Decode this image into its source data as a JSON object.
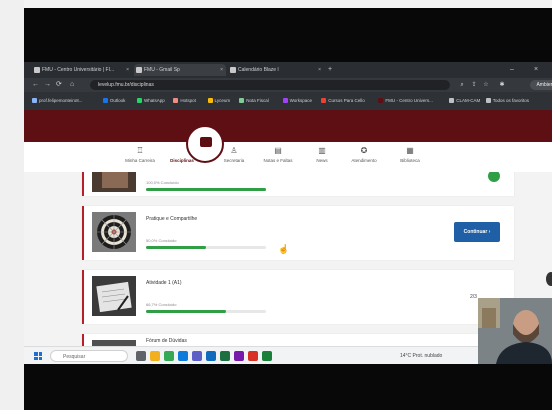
{
  "browser": {
    "tabs": [
      {
        "label": "FMU - Centro Universitário | FI...",
        "active": false
      },
      {
        "label": "FMU - Gmail Sp",
        "active": true
      },
      {
        "label": "Calendário Blaze l",
        "active": false
      }
    ],
    "new_tab": "+",
    "window_controls": {
      "minimize": "–",
      "close": "×"
    },
    "url": "levelup.fmu.br/disciplinas",
    "profile_label": "Ambiente",
    "bookmarks": [
      {
        "label": "prof.felipemonteiro8...",
        "color": "#8ab4f8"
      },
      {
        "label": "Outlook",
        "color": "#1a73e8"
      },
      {
        "label": "WhatsApp",
        "color": "#25d366"
      },
      {
        "label": "Hotspot",
        "color": "#f28b82"
      },
      {
        "label": "Lyceum",
        "color": "#fbbc04"
      },
      {
        "label": "Nota Fiscal",
        "color": "#81c995"
      },
      {
        "label": "Workspace",
        "color": "#a142f4"
      },
      {
        "label": "Cursos Para Cello",
        "color": "#ea4335"
      },
      {
        "label": "FMU - Centro Univers...",
        "color": "#5e0f14"
      },
      {
        "label": "CLAM-CAM",
        "color": "#bdc1c6"
      },
      {
        "label": "Todos os favoritos",
        "color": "#bdc1c6"
      }
    ]
  },
  "nav": {
    "items": [
      {
        "label": "Minha Carreira",
        "icon": "career-icon",
        "glyph": "♖"
      },
      {
        "label": "Disciplinas",
        "icon": "disciplines-icon",
        "glyph": "▣",
        "active": true
      },
      {
        "label": "Secretaria",
        "icon": "secretary-icon",
        "glyph": "♙"
      },
      {
        "label": "Notas e Faltas",
        "icon": "grades-icon",
        "glyph": "▤"
      },
      {
        "label": "News",
        "icon": "news-icon",
        "glyph": "▥"
      },
      {
        "label": "Atendimento",
        "icon": "support-icon",
        "glyph": "✪"
      },
      {
        "label": "Biblioteca",
        "icon": "library-icon",
        "glyph": "▦"
      }
    ]
  },
  "cards": [
    {
      "title": "",
      "progress_text": "100,0% Concluído",
      "progress": 1.0,
      "thumb": "thumb-video"
    },
    {
      "title": "Pratique e Compartilhe",
      "progress_text": "50,0% Concluído",
      "progress": 0.5,
      "thumb": "thumb-dartboard",
      "button": "Continuar  ›"
    },
    {
      "title": "Atividade 1 (A1)",
      "progress_text": "66,7% Concluído",
      "progress": 0.667,
      "thumb": "thumb-writing",
      "steps": "2/3"
    },
    {
      "title": "Fórum de Dúvidas",
      "progress_text": "",
      "progress": 0,
      "thumb": "thumb-forum"
    }
  ],
  "taskbar": {
    "search_placeholder": "Pesquisar",
    "weather": "14°C  Prot. nublado",
    "apps": [
      {
        "icon": "task-view-icon",
        "color": "#5f6368"
      },
      {
        "icon": "file-explorer-icon",
        "color": "#f2b01e"
      },
      {
        "icon": "chrome-icon",
        "color": "#34a853"
      },
      {
        "icon": "edge-icon",
        "color": "#0c7bdc"
      },
      {
        "icon": "teams-icon",
        "color": "#5b5fc7"
      },
      {
        "icon": "outlook-icon",
        "color": "#0f6cbd"
      },
      {
        "icon": "excel-icon",
        "color": "#1d6f42"
      },
      {
        "icon": "onenote-icon",
        "color": "#7719aa"
      },
      {
        "icon": "app-red-icon",
        "color": "#d93025"
      },
      {
        "icon": "app-green-icon",
        "color": "#188038"
      }
    ]
  }
}
